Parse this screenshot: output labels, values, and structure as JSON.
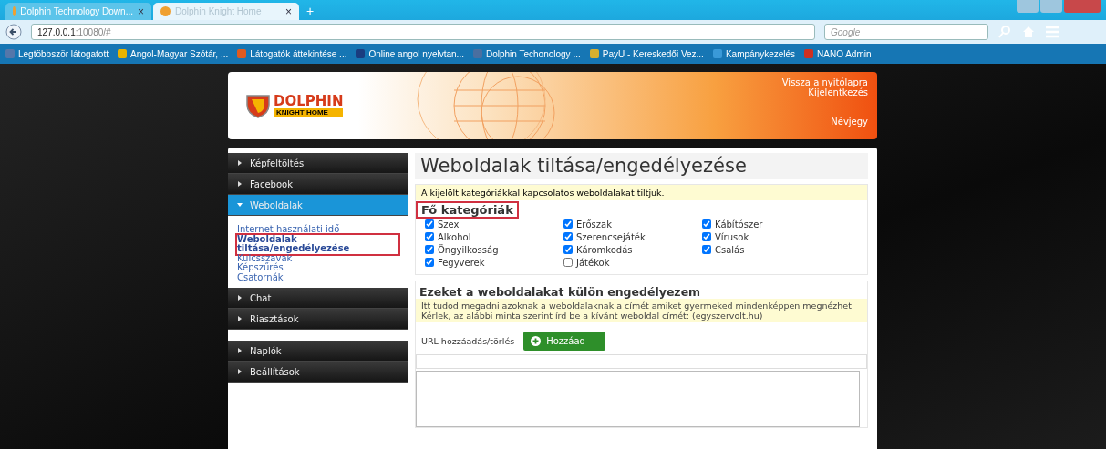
{
  "browser": {
    "tabs": [
      {
        "title": "Dolphin Technology Down...",
        "close": "×",
        "selected": false
      },
      {
        "title": "Dolphin Knight Home",
        "close": "×",
        "selected": true
      }
    ],
    "new_tab": "+",
    "address": {
      "host": "127.0.0.1",
      "rest": ":10080/#"
    },
    "search": {
      "placeholder": "Google"
    },
    "bookmarks": [
      {
        "label": "Legtöbbször látogatott",
        "color": "#5577aa"
      },
      {
        "label": "Angol-Magyar Szótár, ...",
        "color": "#e8b400"
      },
      {
        "label": "Látogatók áttekintése ...",
        "color": "#e05a20"
      },
      {
        "label": "Online angol nyelvtan...",
        "color": "#1a3d80"
      },
      {
        "label": "Dolphin Techonology ...",
        "color": "#4a6fa0"
      },
      {
        "label": "PayU - Kereskedői Vez...",
        "color": "#d8b030"
      },
      {
        "label": "Kampánykezelés",
        "color": "#3a9ad8"
      },
      {
        "label": "NANO Admin",
        "color": "#d03020"
      }
    ]
  },
  "header": {
    "logo": {
      "top": "DOLPHIN",
      "bottom": "KNIGHT HOME"
    },
    "links": [
      "Vissza a nyitólapra",
      "Kijelentkezés"
    ],
    "about": "Névjegy"
  },
  "sidebar": {
    "groups": [
      {
        "items": [
          {
            "label": "Képfeltöltés",
            "expanded": false
          },
          {
            "label": "Facebook",
            "expanded": false
          },
          {
            "label": "Weboldalak",
            "expanded": true,
            "children": [
              {
                "label": "Internet használati idő",
                "selected": false,
                "highlighted": false
              },
              {
                "label": "Weboldalak tiltása/engedélyezése",
                "selected": true,
                "highlighted": true
              },
              {
                "label": "Kulcsszavak",
                "selected": false,
                "highlighted": false
              },
              {
                "label": "Képszűrés",
                "selected": false,
                "highlighted": false
              },
              {
                "label": "Csatornák",
                "selected": false,
                "highlighted": false
              }
            ]
          },
          {
            "label": "Chat",
            "expanded": false
          },
          {
            "label": "Riasztások",
            "expanded": false
          }
        ]
      },
      {
        "items": [
          {
            "label": "Naplók",
            "expanded": false
          },
          {
            "label": "Beállítások",
            "expanded": false
          }
        ]
      }
    ]
  },
  "main": {
    "title": "Weboldalak tiltása/engedélyezése",
    "notice": "A kijelölt kategóriákkal kapcsolatos weboldalakat tiltjuk.",
    "categories_heading": {
      "text": "Fő kategóriák",
      "highlighted": true
    },
    "categories": [
      [
        {
          "label": "Szex",
          "checked": true
        },
        {
          "label": "Alkohol",
          "checked": true
        },
        {
          "label": "Öngyilkosság",
          "checked": true
        },
        {
          "label": "Fegyverek",
          "checked": true
        }
      ],
      [
        {
          "label": "Erőszak",
          "checked": true
        },
        {
          "label": "Szerencsejáték",
          "checked": true
        },
        {
          "label": "Káromkodás",
          "checked": true
        },
        {
          "label": "Játékok",
          "checked": false
        }
      ],
      [
        {
          "label": "Kábítószer",
          "checked": true
        },
        {
          "label": "Vírusok",
          "checked": true
        },
        {
          "label": "Csalás",
          "checked": true
        }
      ]
    ],
    "allow_heading": "Ezeket a weboldalakat külön engedélyezem",
    "allow_notice": "Itt tudod megadni azoknak a weboldalaknak a címét amiket gyermeked mindenképpen megnézhet. Kérlek, az alábbi minta szerint írd be a kívánt weboldal címét: (egyszervolt.hu)",
    "url_label": "URL hozzáadás/törlés",
    "add_button": "Hozzáad"
  }
}
